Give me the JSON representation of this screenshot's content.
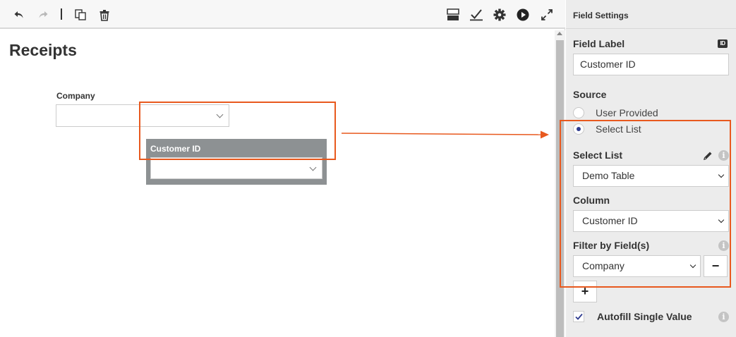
{
  "toolbar": {
    "icons": [
      "undo-icon",
      "redo-icon",
      "copy-icon",
      "delete-icon",
      "layout-icon",
      "validate-icon",
      "settings-icon",
      "preview-icon",
      "expand-icon"
    ]
  },
  "form": {
    "title": "Receipts",
    "company_label": "Company",
    "company_value": "",
    "customer_id_label": "Customer ID",
    "customer_id_value": ""
  },
  "panel": {
    "title": "Field Settings",
    "field_label": {
      "label": "Field Label",
      "value": "Customer ID",
      "id_badge": "ID"
    },
    "source": {
      "label": "Source",
      "options": [
        "User Provided",
        "Select List"
      ],
      "selected": "Select List"
    },
    "select_list": {
      "label": "Select List",
      "value": "Demo Table"
    },
    "column": {
      "label": "Column",
      "value": "Customer ID"
    },
    "filter": {
      "label": "Filter by Field(s)",
      "value": "Company",
      "remove_label": "−",
      "add_label": "+"
    },
    "autofill": {
      "label": "Autofill Single Value",
      "checked": true
    },
    "info_glyph": "i"
  },
  "colors": {
    "highlight": "#e8591e",
    "radio_selected": "#2f3c8f",
    "field_block": "#8d9193"
  }
}
